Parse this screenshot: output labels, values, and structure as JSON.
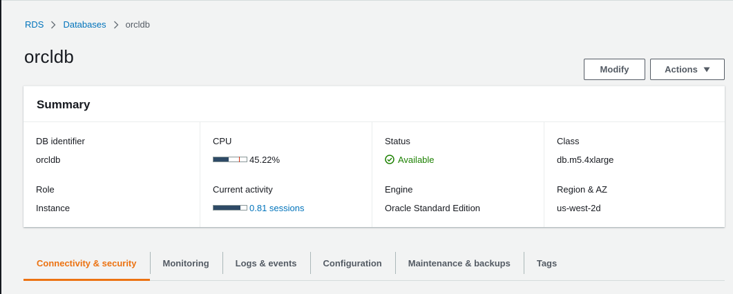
{
  "breadcrumb": {
    "rds": "RDS",
    "databases": "Databases",
    "current": "orcldb"
  },
  "page_title": "orcldb",
  "actions": {
    "modify": "Modify",
    "actions": "Actions"
  },
  "summary": {
    "title": "Summary",
    "db_identifier": {
      "label": "DB identifier",
      "value": "orcldb"
    },
    "role": {
      "label": "Role",
      "value": "Instance"
    },
    "cpu": {
      "label": "CPU",
      "value": "45.22%",
      "fraction": 0.4522
    },
    "current_activity": {
      "label": "Current activity",
      "value": "0.81 sessions",
      "fraction": 0.81
    },
    "status": {
      "label": "Status",
      "value": "Available"
    },
    "engine": {
      "label": "Engine",
      "value": "Oracle Standard Edition"
    },
    "class": {
      "label": "Class",
      "value": "db.m5.4xlarge"
    },
    "region": {
      "label": "Region & AZ",
      "value": "us-west-2d"
    }
  },
  "tabs": [
    {
      "label": "Connectivity & security",
      "active": true
    },
    {
      "label": "Monitoring",
      "active": false
    },
    {
      "label": "Logs & events",
      "active": false
    },
    {
      "label": "Configuration",
      "active": false
    },
    {
      "label": "Maintenance & backups",
      "active": false
    },
    {
      "label": "Tags",
      "active": false
    }
  ],
  "colors": {
    "link": "#0073bb",
    "accent": "#ec7211",
    "success": "#1d8102",
    "meter_fill": "#2e4a66",
    "meter_activity": "#0073bb",
    "meter_threshold": "#d13212"
  },
  "icons": {
    "breadcrumb_separator": "chevron-right-icon",
    "actions_caret": "caret-down-icon",
    "status": "check-circle-icon"
  }
}
